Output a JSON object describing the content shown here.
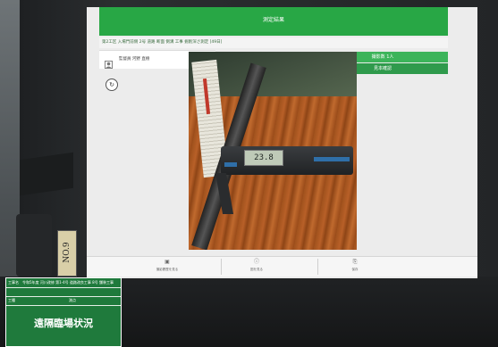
{
  "app": {
    "title": "測定結果",
    "info_line": "第2工区 入場門前側 2号 道路 断面 側溝 工事 掘削深さ測定 [49日]",
    "user_label": "監督員 河野 直樹",
    "count_button": "撮影数 1人",
    "confirm_button": "見本確認",
    "rotate_icon": "rotate-icon"
  },
  "toolbar": {
    "items": [
      {
        "icon": "camera-icon",
        "label": "撮影履歴を見る"
      },
      {
        "icon": "info-icon",
        "label": "図を見る"
      },
      {
        "icon": "save-icon",
        "label": "保存"
      }
    ]
  },
  "camera": {
    "lcd_value": "23.8"
  },
  "plate": {
    "number": "NO.9"
  },
  "sign": {
    "label_project": "工事名",
    "project_name": "令和5年度 河川改修 第1-4号 道路改良工事 8号 舗装工事",
    "label_type": "工種",
    "label_date": "測点",
    "title": "遠隔臨場状況"
  }
}
